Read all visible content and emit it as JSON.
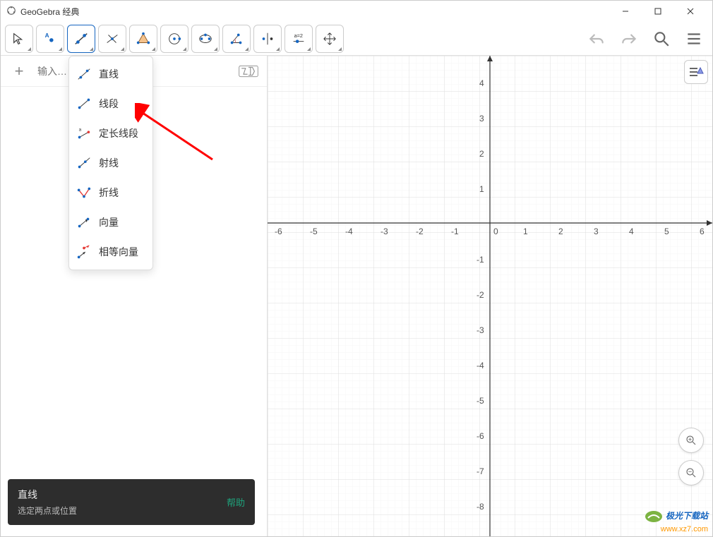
{
  "window": {
    "title": "GeoGebra 经典"
  },
  "toolbar": {
    "tools": [
      "move",
      "point",
      "line",
      "perpendicular",
      "polygon",
      "circle",
      "ellipse",
      "angle",
      "reflect",
      "slider",
      "move-view"
    ],
    "selected_index": 2
  },
  "input": {
    "placeholder": "输入…"
  },
  "dropdown": {
    "items": [
      {
        "key": "line",
        "label": "直线"
      },
      {
        "key": "segment",
        "label": "线段"
      },
      {
        "key": "segment-fixed",
        "label": "定长线段"
      },
      {
        "key": "ray",
        "label": "射线"
      },
      {
        "key": "polyline",
        "label": "折线"
      },
      {
        "key": "vector",
        "label": "向量"
      },
      {
        "key": "vector-equal",
        "label": "相等向量"
      }
    ]
  },
  "tooltip": {
    "title": "直线",
    "desc": "选定两点或位置",
    "help": "帮助"
  },
  "graph": {
    "x_ticks": [
      -6,
      -5,
      -4,
      -3,
      -2,
      -1,
      0,
      1,
      2,
      3,
      4,
      5,
      6
    ],
    "y_ticks": [
      4,
      3,
      2,
      1,
      -1,
      -2,
      -3,
      -4,
      -5,
      -6,
      -7,
      -8
    ]
  },
  "watermark": {
    "line1": "极光下载站",
    "line2": "www.xz7.com"
  }
}
